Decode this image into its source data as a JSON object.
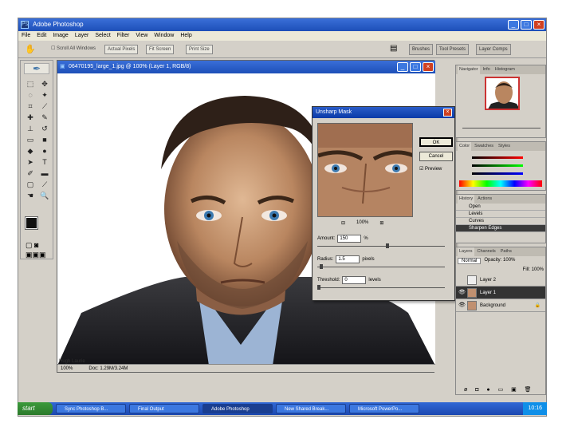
{
  "window": {
    "title": "Adobe Photoshop"
  },
  "menu": [
    "File",
    "Edit",
    "Image",
    "Layer",
    "Select",
    "Filter",
    "View",
    "Window",
    "Help"
  ],
  "options": {
    "tool_icon": "marquee-icon",
    "scroll_all": "Scroll All Windows",
    "btn1": "Actual Pixels",
    "btn2": "Fit Screen",
    "btn3": "Print Size",
    "tabs": [
      "Brushes",
      "Tool Presets",
      "Layer Comps"
    ]
  },
  "document": {
    "title": "06470195_large_1.jpg @ 100% (Layer 1, RGB/8)",
    "zoom": "100%",
    "doc_size": "Doc: 1.29M/3.24M",
    "image_label": "Hugh Laurie"
  },
  "dialog": {
    "title": "Unsharp Mask",
    "ok": "OK",
    "cancel": "Cancel",
    "preview_label": "Preview",
    "zoom": "100%",
    "amount_label": "Amount:",
    "amount_value": "150",
    "amount_unit": "%",
    "amount_level": 0.55,
    "radius_label": "Radius:",
    "radius_value": "1.5",
    "radius_unit": "pixels",
    "radius_level": 0.02,
    "threshold_label": "Threshold:",
    "threshold_value": "0",
    "threshold_unit": "levels",
    "threshold_level": 0.0
  },
  "panels": {
    "navigator_tabs": [
      "Navigator",
      "Info",
      "Histogram"
    ],
    "color_tabs": [
      "Color",
      "Swatches",
      "Styles"
    ],
    "history_tabs": [
      "History",
      "Actions"
    ],
    "history_items": [
      "Open",
      "Levels",
      "Curves",
      "Sharpen Edges"
    ],
    "layers_tabs": [
      "Layers",
      "Channels",
      "Paths"
    ],
    "blend_mode": "Normal",
    "opacity": "Opacity: 100%",
    "fill": "Fill: 100%",
    "layers": [
      "Layer 2",
      "Layer 1",
      "Background"
    ]
  },
  "taskbar": {
    "start": "start",
    "tasks": [
      "Sync Photoshop B...",
      "Final Output",
      "Adobe Photoshop",
      "New Shared Break...",
      "Microsoft PowerPo..."
    ],
    "clock": "10:16"
  }
}
